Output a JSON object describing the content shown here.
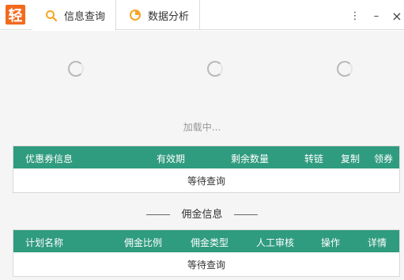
{
  "app": {
    "logo_text": "轻"
  },
  "tabs": [
    {
      "label": "信息查询",
      "icon": "search-icon",
      "active": true
    },
    {
      "label": "数据分析",
      "icon": "pie-chart-icon",
      "active": false
    }
  ],
  "window_controls": {
    "menu": "⋮",
    "minimize": "–",
    "close": "×"
  },
  "loading": {
    "text": "加载中..."
  },
  "coupon_table": {
    "headers": [
      "优惠券信息",
      "有效期",
      "剩余数量",
      "转链",
      "复制",
      "领券"
    ],
    "empty_text": "等待查询"
  },
  "commission_section": {
    "title": "佣金信息"
  },
  "commission_table": {
    "headers": [
      "计划名称",
      "佣金比例",
      "佣金类型",
      "人工审核",
      "操作",
      "详情"
    ],
    "empty_text": "等待查询"
  },
  "colors": {
    "accent": "#f36a1e",
    "table_header": "#2f9b7f",
    "tab_icon": "#f5a623"
  }
}
